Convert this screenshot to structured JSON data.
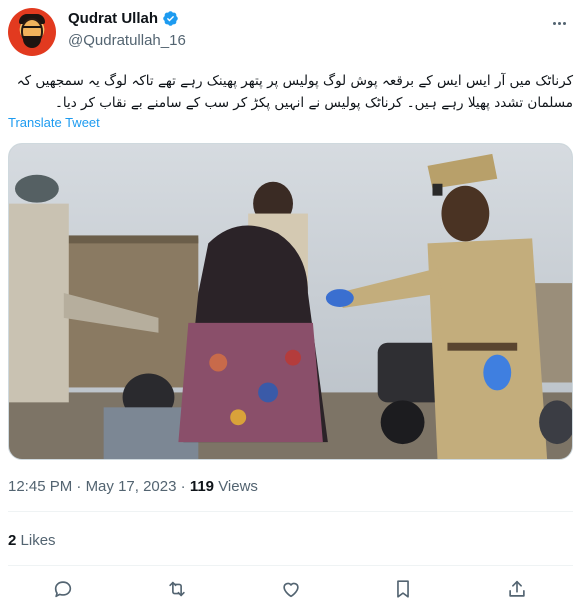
{
  "author": {
    "name": "Qudrat Ullah",
    "handle": "@Qudratullah_16",
    "verified_icon": "verified-badge-icon",
    "accent_color": "#1d9bf0"
  },
  "tweet": {
    "text": "کرناٹک میں آر ایس ایس کے برقعہ پوش لوگ پولیس پر پتھر پھینک رہے تھے تاکہ لوگ یہ سمجھیں کہ مسلمان تشدد پھیلا رہے ہیں۔ کرناٹک پولیس نے انہیں پکڑ کر سب کے سامنے بے نقاب کر دیا۔",
    "translate_label": "Translate Tweet"
  },
  "meta": {
    "time": "12:45 PM",
    "separator": "·",
    "date": "May 17, 2023",
    "views_count": "119",
    "views_label": "Views"
  },
  "engagement": {
    "likes_count": "2",
    "likes_label": "Likes"
  },
  "actions": {
    "reply_icon": "reply-icon",
    "retweet_icon": "retweet-icon",
    "like_icon": "like-icon",
    "bookmark_icon": "bookmark-icon",
    "share_icon": "share-icon"
  }
}
